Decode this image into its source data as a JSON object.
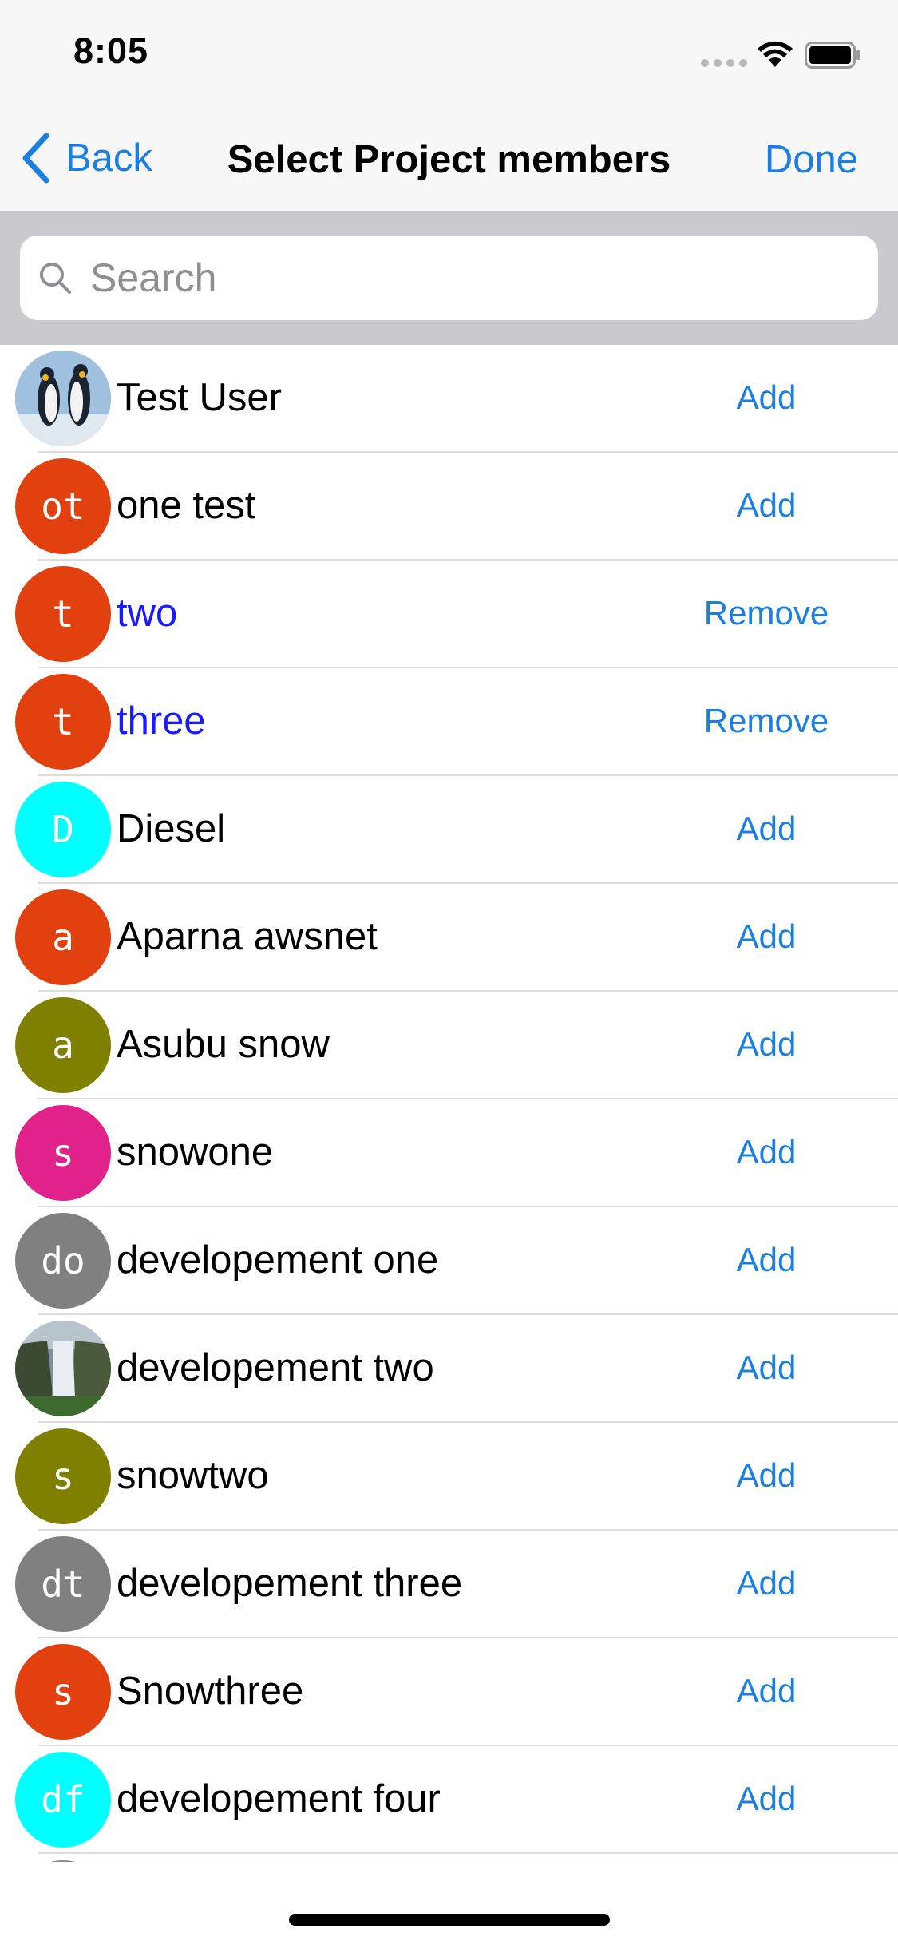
{
  "status_bar": {
    "time": "8:05"
  },
  "nav": {
    "back_label": "Back",
    "title": "Select Project members",
    "done_label": "Done"
  },
  "search": {
    "placeholder": "Search"
  },
  "colors": {
    "accent": "#1a7fe0",
    "selected_name": "#1a1aff"
  },
  "members": [
    {
      "name": "Test User",
      "avatar_type": "photo-penguins",
      "initials": "",
      "avatar_color": "#6a8fb8",
      "action": "Add",
      "selected": false
    },
    {
      "name": "one test",
      "avatar_type": "initials",
      "initials": "ot",
      "avatar_color": "#e2410f",
      "action": "Add",
      "selected": false
    },
    {
      "name": "two",
      "avatar_type": "initials",
      "initials": "t",
      "avatar_color": "#e2410f",
      "action": "Remove",
      "selected": true
    },
    {
      "name": "three",
      "avatar_type": "initials",
      "initials": "t",
      "avatar_color": "#e2410f",
      "action": "Remove",
      "selected": true
    },
    {
      "name": "Diesel",
      "avatar_type": "initials",
      "initials": "D",
      "avatar_color": "#00ffff",
      "action": "Add",
      "selected": false
    },
    {
      "name": "Aparna awsnet",
      "avatar_type": "initials",
      "initials": "a",
      "avatar_color": "#e2410f",
      "action": "Add",
      "selected": false
    },
    {
      "name": "Asubu snow",
      "avatar_type": "initials",
      "initials": "a",
      "avatar_color": "#808000",
      "action": "Add",
      "selected": false
    },
    {
      "name": "snowone",
      "avatar_type": "initials",
      "initials": "s",
      "avatar_color": "#e0228a",
      "action": "Add",
      "selected": false
    },
    {
      "name": "developement one",
      "avatar_type": "initials",
      "initials": "do",
      "avatar_color": "#808080",
      "action": "Add",
      "selected": false
    },
    {
      "name": "developement two",
      "avatar_type": "photo-waterfall",
      "initials": "",
      "avatar_color": "#4a6a3a",
      "action": "Add",
      "selected": false
    },
    {
      "name": "snowtwo",
      "avatar_type": "initials",
      "initials": "s",
      "avatar_color": "#808000",
      "action": "Add",
      "selected": false
    },
    {
      "name": "developement three",
      "avatar_type": "initials",
      "initials": "dt",
      "avatar_color": "#808080",
      "action": "Add",
      "selected": false
    },
    {
      "name": "Snowthree",
      "avatar_type": "initials",
      "initials": "s",
      "avatar_color": "#e2410f",
      "action": "Add",
      "selected": false
    },
    {
      "name": "developement four",
      "avatar_type": "initials",
      "initials": "df",
      "avatar_color": "#00ffff",
      "action": "Add",
      "selected": false
    }
  ]
}
